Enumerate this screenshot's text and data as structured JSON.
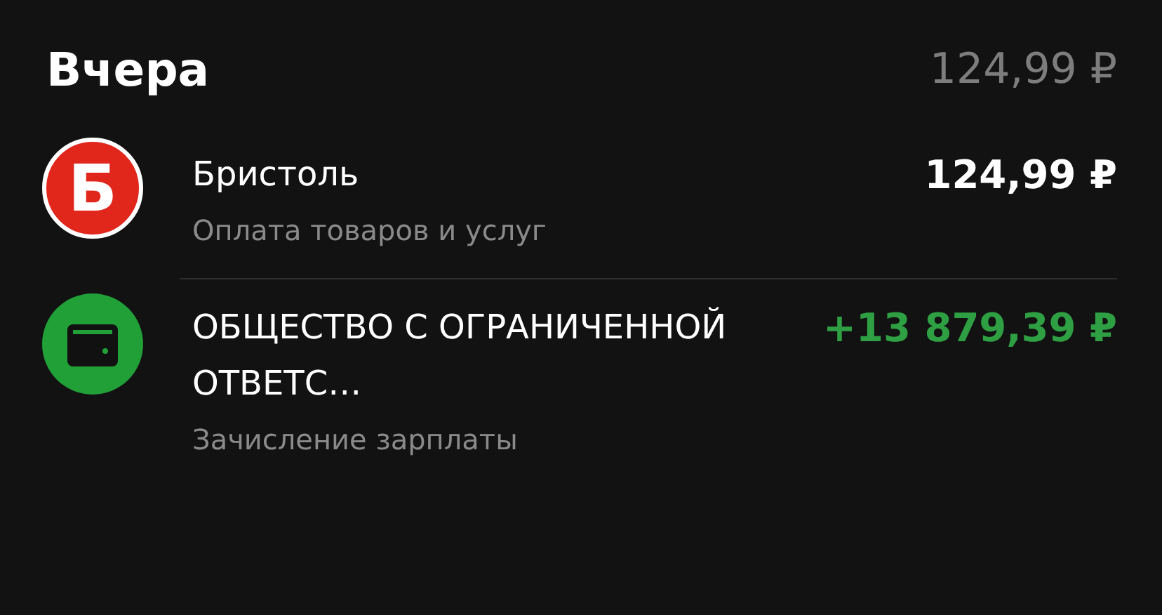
{
  "day": {
    "title": "Вчера",
    "total": "124,99 ₽"
  },
  "transactions": [
    {
      "kind": "logo",
      "logo_letter": "Б",
      "name": "Бристоль",
      "category": "Оплата товаров и услуг",
      "amount": "124,99 ₽",
      "color": "#ffffff"
    },
    {
      "kind": "wallet",
      "name": "ОБЩЕСТВО С ОГРАНИЧЕННОЙ ОТВЕТС…",
      "category": "Зачисление зарплаты",
      "amount": "+13 879,39 ₽",
      "color": "#2ea043"
    }
  ]
}
